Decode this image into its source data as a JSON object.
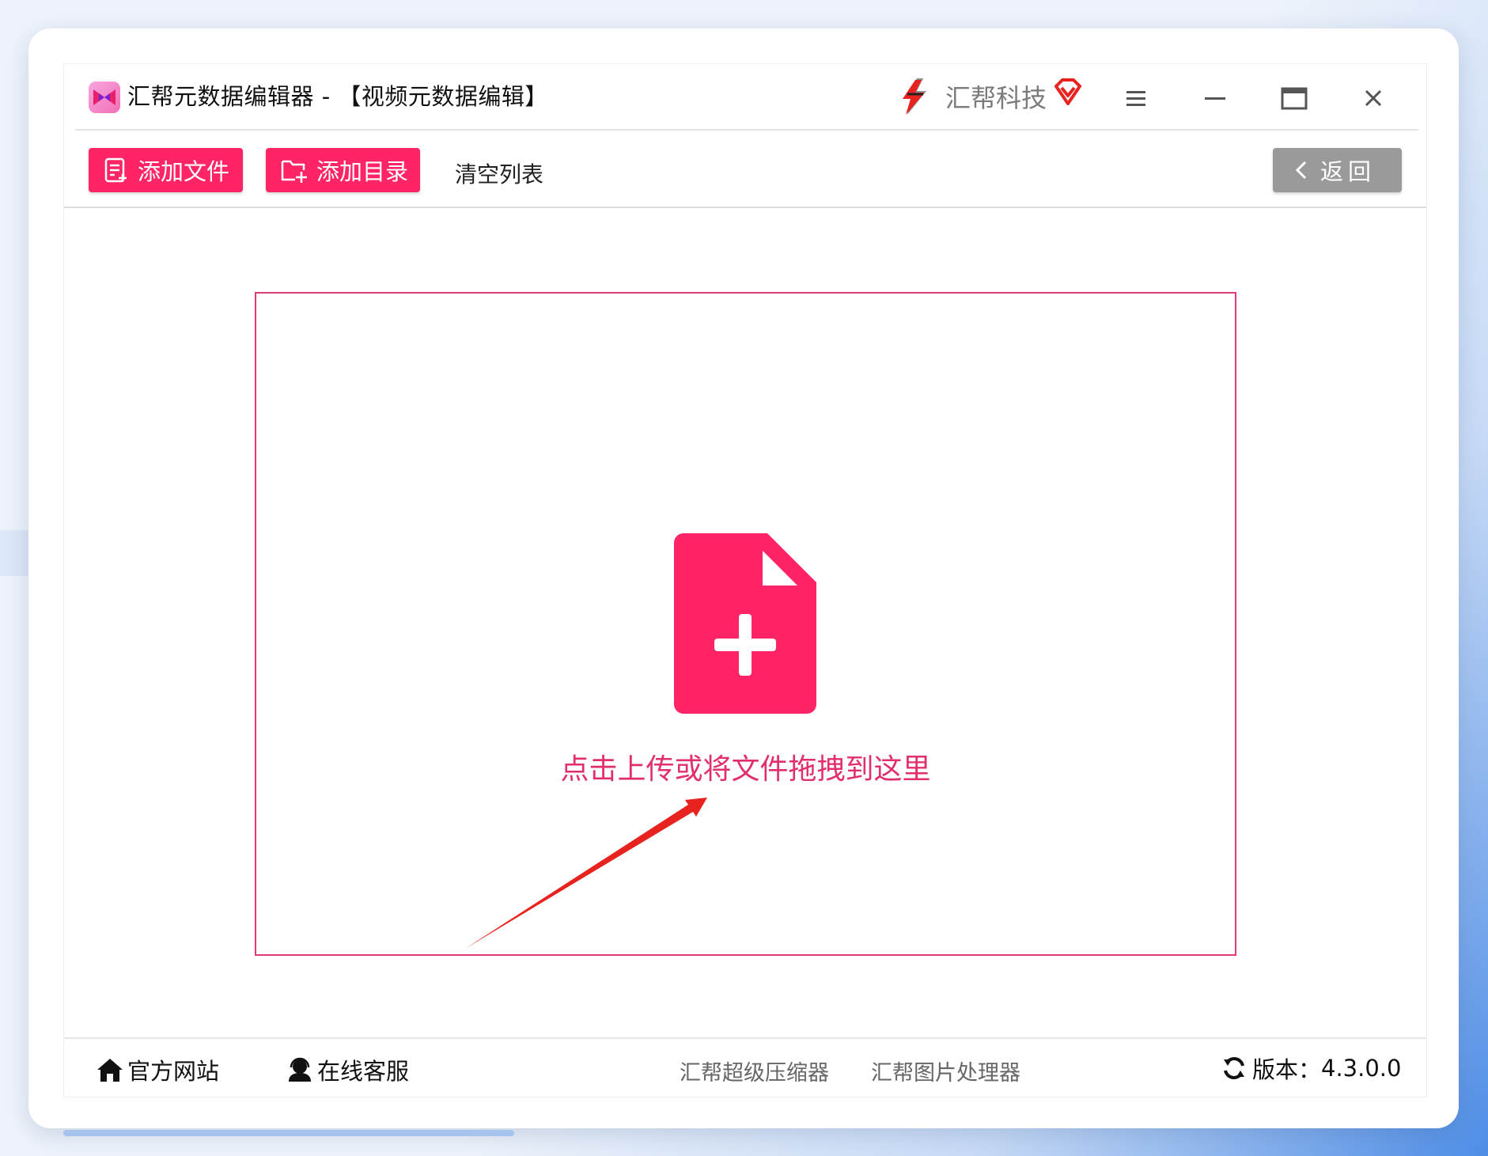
{
  "window": {
    "title": "汇帮元数据编辑器 - 【视频元数据编辑】",
    "brand": "汇帮科技"
  },
  "toolbar": {
    "add_file_label": "添加文件",
    "add_dir_label": "添加目录",
    "clear_label": "清空列表",
    "back_label": "返回"
  },
  "dropzone": {
    "hint": "点击上传或将文件拖拽到这里"
  },
  "footer": {
    "official_site": "官方网站",
    "online_service": "在线客服",
    "compressor": "汇帮超级压缩器",
    "image_processor": "汇帮图片处理器",
    "version_label": "版本：",
    "version_value": "4.3.0.0"
  },
  "colors": {
    "accent": "#ff2466",
    "dropzone_border": "#e03a78",
    "back_button": "#9a9a9a",
    "arrow": "#e8231f"
  },
  "icons": [
    "app-logo-icon",
    "brand-logo-icon",
    "vip-diamond-icon",
    "menu-icon",
    "minimize-icon",
    "maximize-icon",
    "close-icon",
    "add-file-icon",
    "add-folder-icon",
    "chevron-left-icon",
    "file-plus-icon",
    "home-icon",
    "customer-service-icon",
    "refresh-icon"
  ]
}
